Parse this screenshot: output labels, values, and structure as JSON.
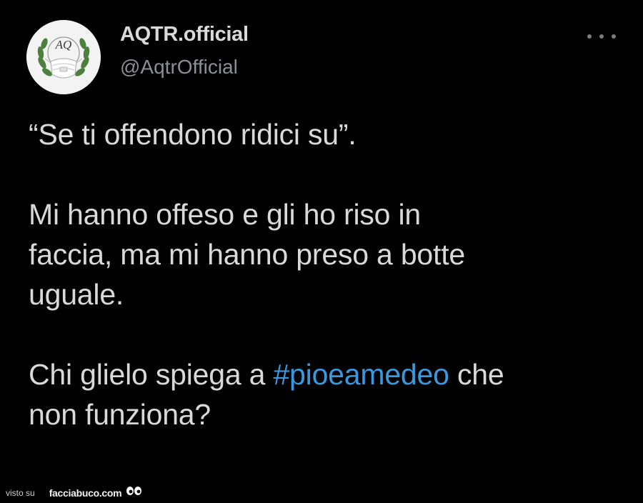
{
  "tweet": {
    "author": {
      "name": "AQTR.official",
      "handle": "@AqtrOfficial",
      "avatar_text": "AQ"
    },
    "more_icon": "ellipsis-horizontal-icon",
    "paragraphs": {
      "p1": "“Se ti offendono ridici su”.",
      "p2_line1": "Mi hanno offeso e gli ho riso in",
      "p2_line2": "faccia, ma mi hanno preso a botte",
      "p2_line3": "uguale.",
      "p3_before": "Chi glielo spiega a ",
      "p3_hashtag": "#pioeamedeo",
      "p3_after": " che",
      "p3_line2": "non funziona?"
    },
    "colors": {
      "background": "#000000",
      "text": "#d9d9d9",
      "secondary": "#8b8f93",
      "hashtag": "#3a98de"
    }
  },
  "watermark": {
    "prefix": "visto su",
    "site": "facciabuco.com",
    "icon": "eyes-icon"
  }
}
